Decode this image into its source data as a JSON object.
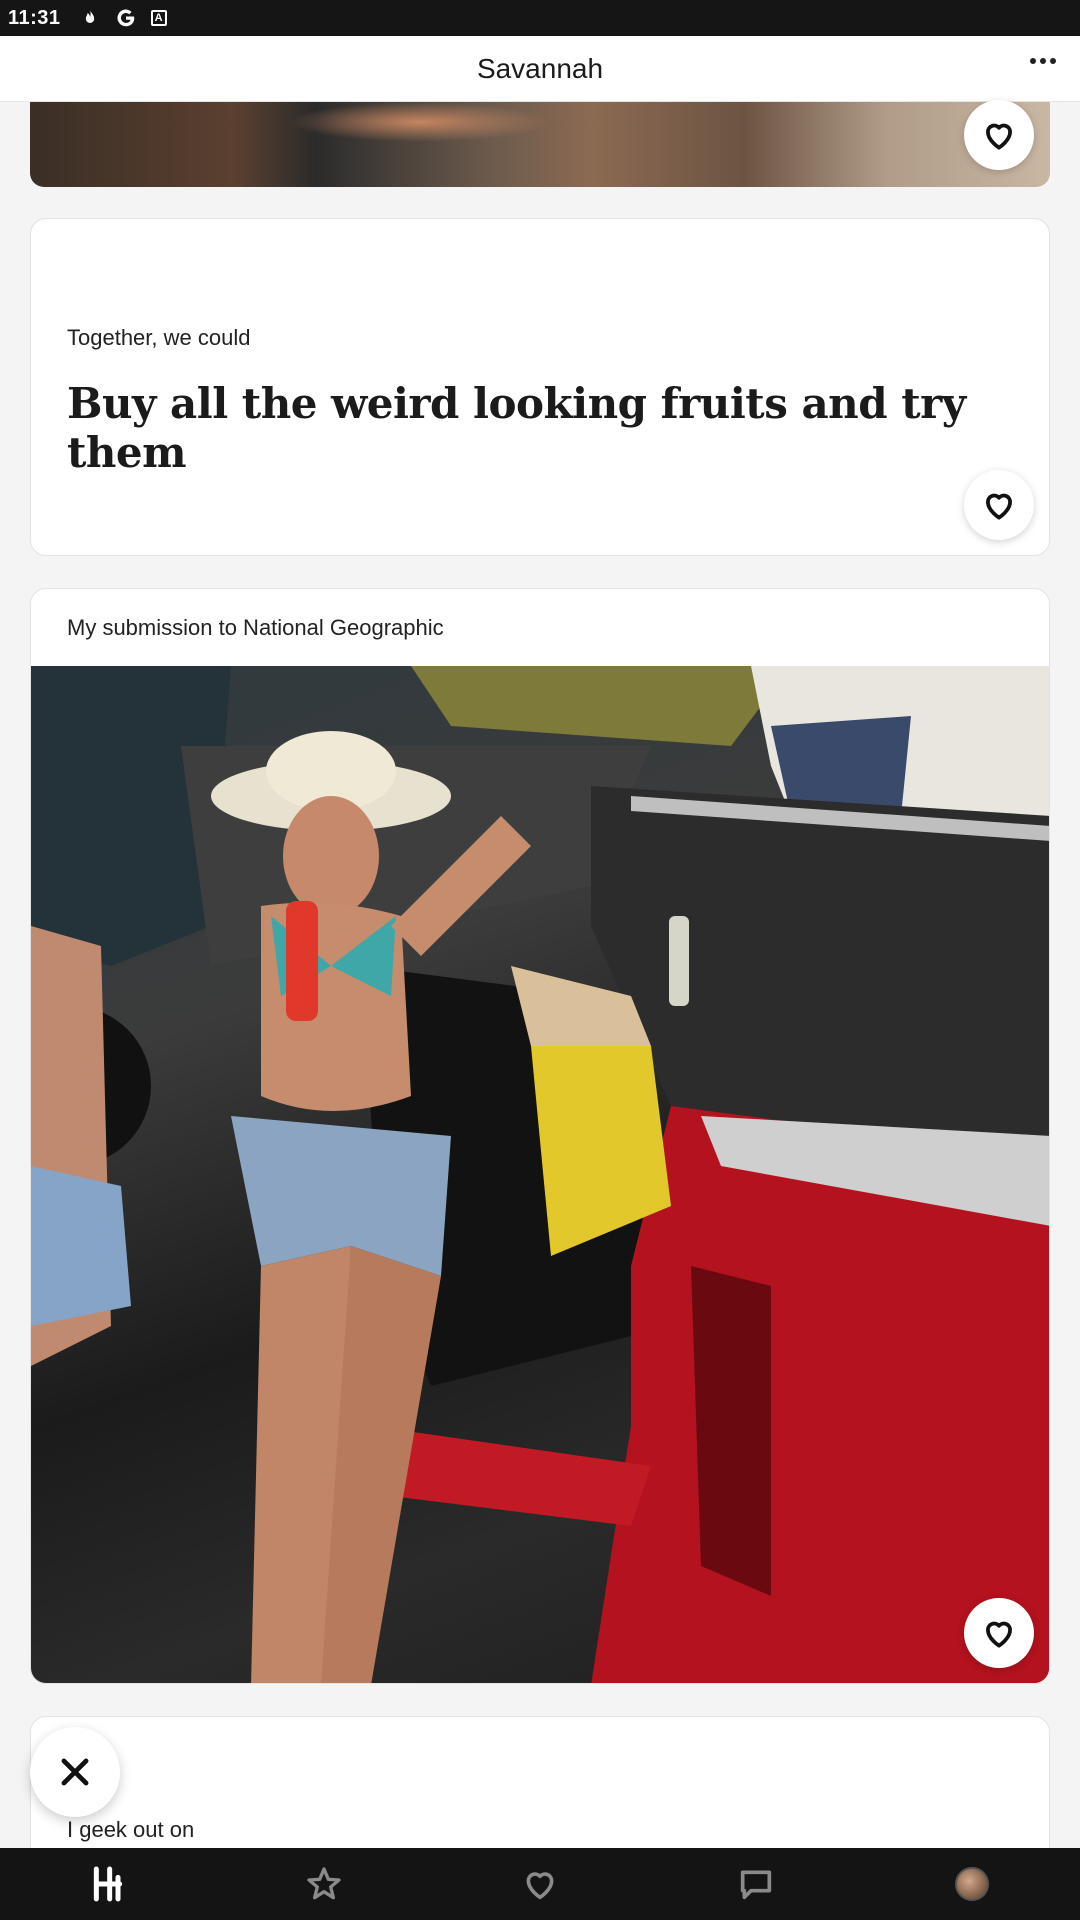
{
  "status_bar": {
    "time": "11:31",
    "icons": [
      "tinder-flame-icon",
      "google-icon",
      "accessibility-icon"
    ]
  },
  "header": {
    "title": "Savannah"
  },
  "prompt_card": {
    "question": "Together, we could",
    "answer": "Buy all the weird looking fruits and try them"
  },
  "photo_card": {
    "caption": "My submission to National Geographic"
  },
  "next_card": {
    "question": "I geek out on"
  },
  "bottom_nav": {
    "items": [
      "home-icon",
      "star-icon",
      "heart-icon",
      "chat-icon",
      "profile-avatar"
    ]
  },
  "colors": {
    "nav_bg": "#141414",
    "status_bg": "#151515",
    "card_bg": "#ffffff",
    "page_bg": "#f4f4f4"
  }
}
